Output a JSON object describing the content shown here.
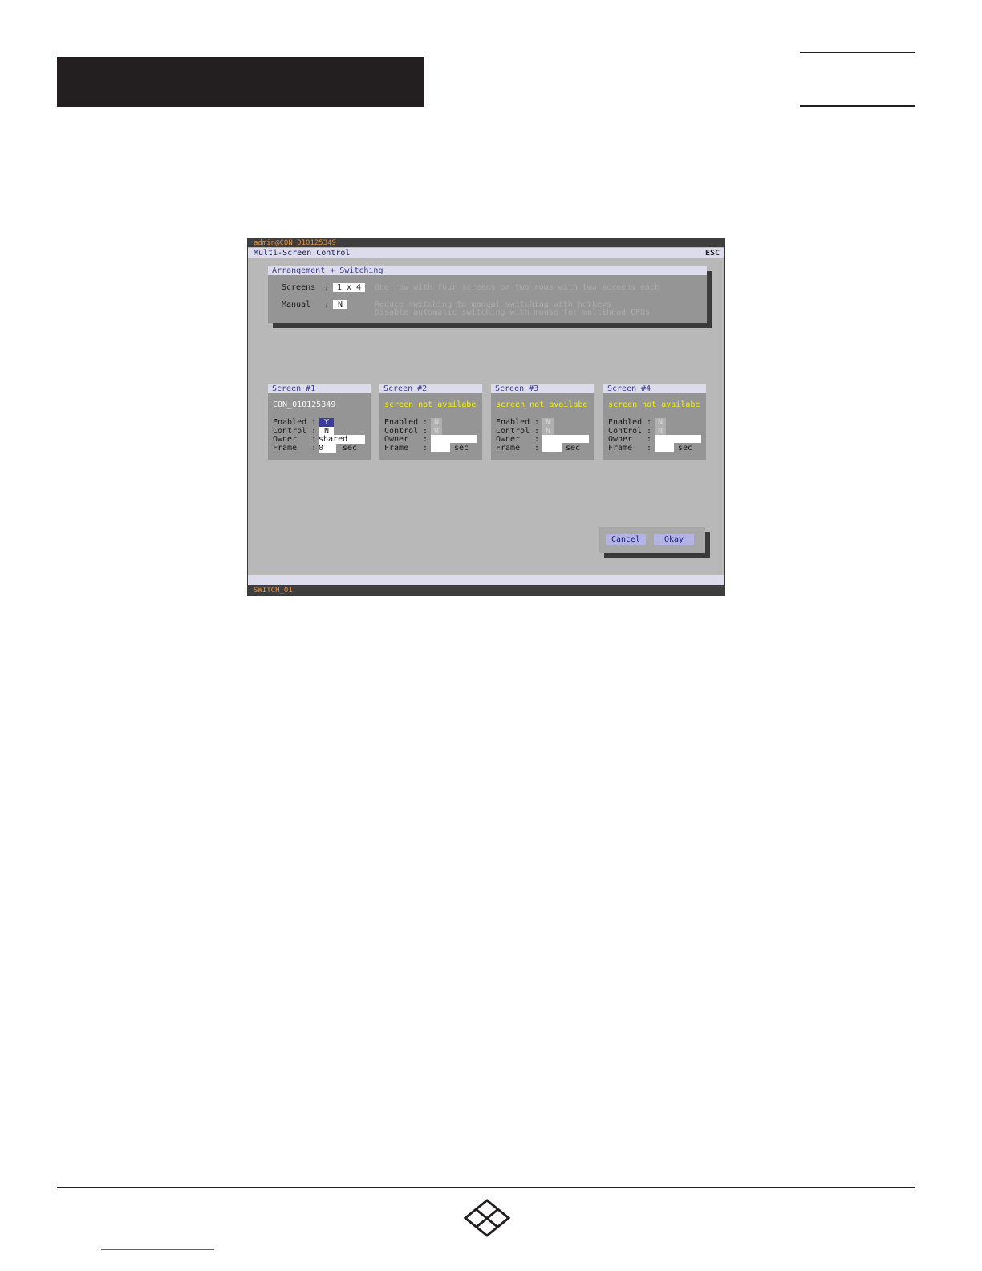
{
  "terminal": {
    "user_host": "admin@CON_010125349",
    "title": "Multi-Screen Control",
    "esc_label": "ESC",
    "arrangement": {
      "header": "Arrangement + Switching",
      "screens_label": "Screens",
      "screens_value": "1 x 4",
      "screens_hint": "One row with four screens or two rows with two screens each",
      "manual_label": "Manual",
      "manual_value": "N",
      "manual_hint_1": "Reduce switching to manual switching with hotkeys",
      "manual_hint_2": "Disable automatic switching with mouse for multihead CPUs"
    },
    "field_labels": {
      "enabled": "Enabled",
      "control": "Control",
      "owner": "Owner",
      "frame": "Frame",
      "sep": ":",
      "sec": "sec"
    },
    "screens": [
      {
        "header": "Screen #1",
        "name": "CON_010125349",
        "enabled": "Y",
        "control": "N",
        "owner": "shared",
        "frame": "0"
      },
      {
        "header": "Screen #2",
        "name": "screen not availabe",
        "enabled": "N",
        "control": "N",
        "owner": "",
        "frame": ""
      },
      {
        "header": "Screen #3",
        "name": "screen not availabe",
        "enabled": "N",
        "control": "N",
        "owner": "",
        "frame": ""
      },
      {
        "header": "Screen #4",
        "name": "screen not availabe",
        "enabled": "N",
        "control": "N",
        "owner": "",
        "frame": ""
      }
    ],
    "cancel_label": "Cancel",
    "okay_label": "Okay",
    "status": "SWITCH_01"
  },
  "colors": {
    "terminal_bg": "#b8b8b8",
    "panel": "#959595",
    "header_light": "#dcdcec",
    "status_text": "#e8903a",
    "unavailable_text": "#f2f200",
    "selected_field": "#3a3aa0"
  },
  "icons": [
    "black-box-logo-icon"
  ]
}
